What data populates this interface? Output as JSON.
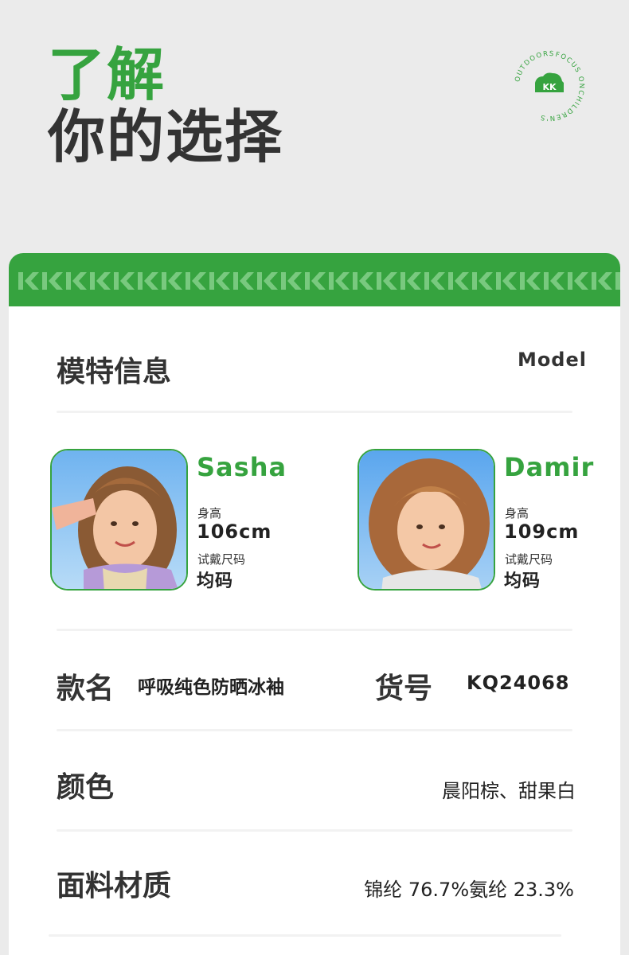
{
  "header": {
    "title_line1": "了解",
    "title_line2": "你的选择"
  },
  "badge": {
    "text_top": "FOCUS ON",
    "text_right": "CHILDREN'S",
    "text_left": "OUTDOORS",
    "logo": "KK"
  },
  "colors": {
    "brand_green": "#36a33f",
    "text_dark": "#333333",
    "page_bg": "#ebebeb"
  },
  "card": {
    "band_pattern_icon": "kk-chevron-pattern",
    "model_section": {
      "title": "模特信息",
      "title_en": "Model",
      "models": [
        {
          "name": "Sasha",
          "height_label": "身高",
          "height": "106cm",
          "size_label": "试戴尺码",
          "size": "均码"
        },
        {
          "name": "Damir",
          "height_label": "身高",
          "height": "109cm",
          "size_label": "试戴尺码",
          "size": "均码"
        }
      ]
    },
    "product": {
      "name_label": "款名",
      "name_value": "呼吸纯色防晒冰袖",
      "sku_label": "货号",
      "sku_value": "KQ24068"
    },
    "color_row": {
      "label": "颜色",
      "value": "晨阳棕、甜果白"
    },
    "material_row": {
      "label": "面料材质",
      "value": "锦纶 76.7%氨纶 23.3%"
    }
  }
}
